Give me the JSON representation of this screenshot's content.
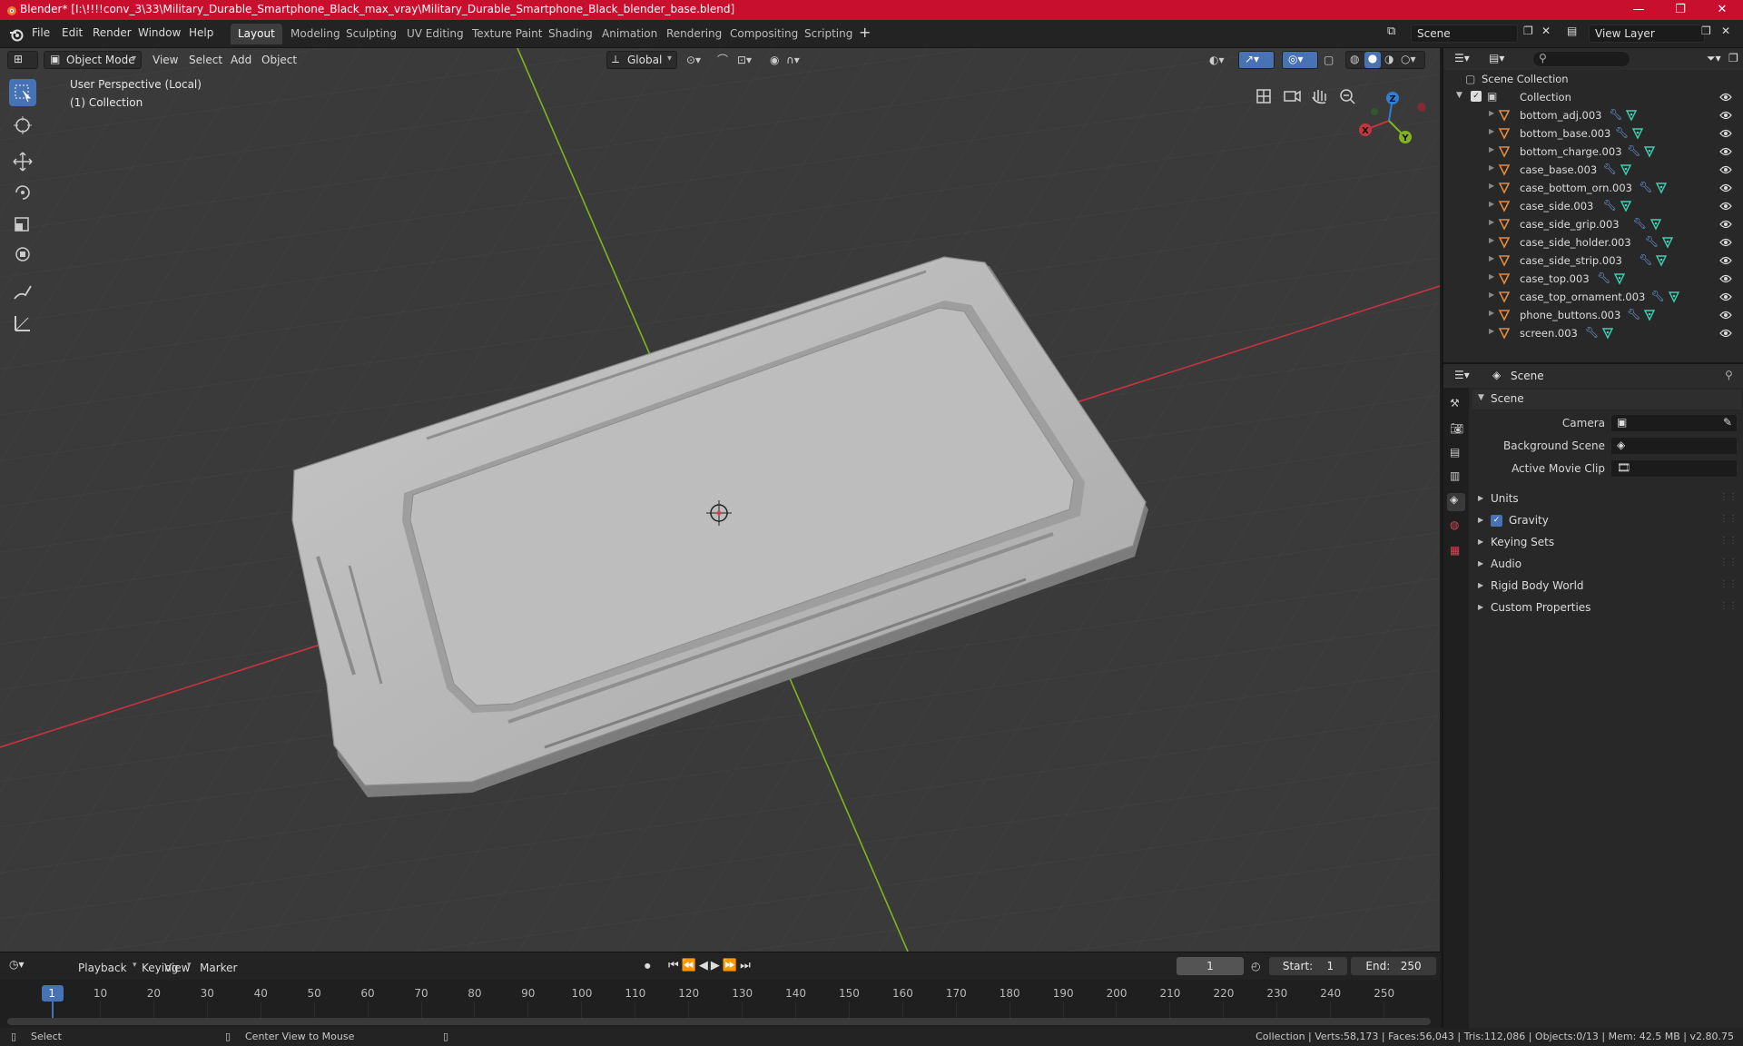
{
  "window": {
    "title": "Blender* [I:\\!!!!conv_3\\33\\Military_Durable_Smartphone_Black_max_vray\\Military_Durable_Smartphone_Black_blender_base.blend]",
    "controls": [
      "—",
      "❐",
      "✕"
    ]
  },
  "menu": [
    "File",
    "Edit",
    "Render",
    "Window",
    "Help"
  ],
  "workspaces": [
    "Layout",
    "Modeling",
    "Sculpting",
    "UV Editing",
    "Texture Paint",
    "Shading",
    "Animation",
    "Rendering",
    "Compositing",
    "Scripting"
  ],
  "active_workspace": "Layout",
  "scene_name": "Scene",
  "view_layer": "View Layer",
  "viewport": {
    "mode": "Object Mode",
    "menus": [
      "View",
      "Select",
      "Add",
      "Object"
    ],
    "orientation": "Global",
    "info_line1": "User Perspective (Local)",
    "info_line2": "(1) Collection",
    "gizmo": {
      "x": "X",
      "y": "Y",
      "z": "Z"
    }
  },
  "outliner": {
    "root": "Scene Collection",
    "collection": "Collection",
    "objects": [
      "bottom_adj.003",
      "bottom_base.003",
      "bottom_charge.003",
      "case_base.003",
      "case_bottom_orn.003",
      "case_side.003",
      "case_side_grip.003",
      "case_side_holder.003",
      "case_side_strip.003",
      "case_top.003",
      "case_top_ornament.003",
      "phone_buttons.003",
      "screen.003"
    ]
  },
  "properties": {
    "context": "Scene",
    "panel": "Scene",
    "camera_label": "Camera",
    "background_scene_label": "Background Scene",
    "active_movie_clip_label": "Active Movie Clip",
    "subpanels": [
      "Units",
      "Gravity",
      "Keying Sets",
      "Audio",
      "Rigid Body World",
      "Custom Properties"
    ],
    "gravity_checked": true
  },
  "timeline": {
    "menus": [
      "Playback",
      "Keying",
      "View",
      "Marker"
    ],
    "current_frame": "1",
    "start_label": "Start:",
    "start": "1",
    "end_label": "End:",
    "end": "250",
    "ticks": [
      "1",
      "10",
      "20",
      "30",
      "40",
      "50",
      "60",
      "70",
      "80",
      "90",
      "100",
      "110",
      "120",
      "130",
      "140",
      "150",
      "160",
      "170",
      "180",
      "190",
      "200",
      "210",
      "220",
      "230",
      "240",
      "250"
    ]
  },
  "status": {
    "left_action": "Select",
    "mid_action": "Center View to Mouse",
    "stats": "Collection | Verts:58,173 | Faces:56,043 | Tris:112,086 | Objects:0/13 | Mem: 42.5 MB | v2.80.75"
  },
  "colors": {
    "title_bar": "#c8102e",
    "accent": "#4772b3",
    "x_axis": "#c8333f",
    "y_axis": "#82b31d",
    "object_icon": "#e08a3c"
  }
}
